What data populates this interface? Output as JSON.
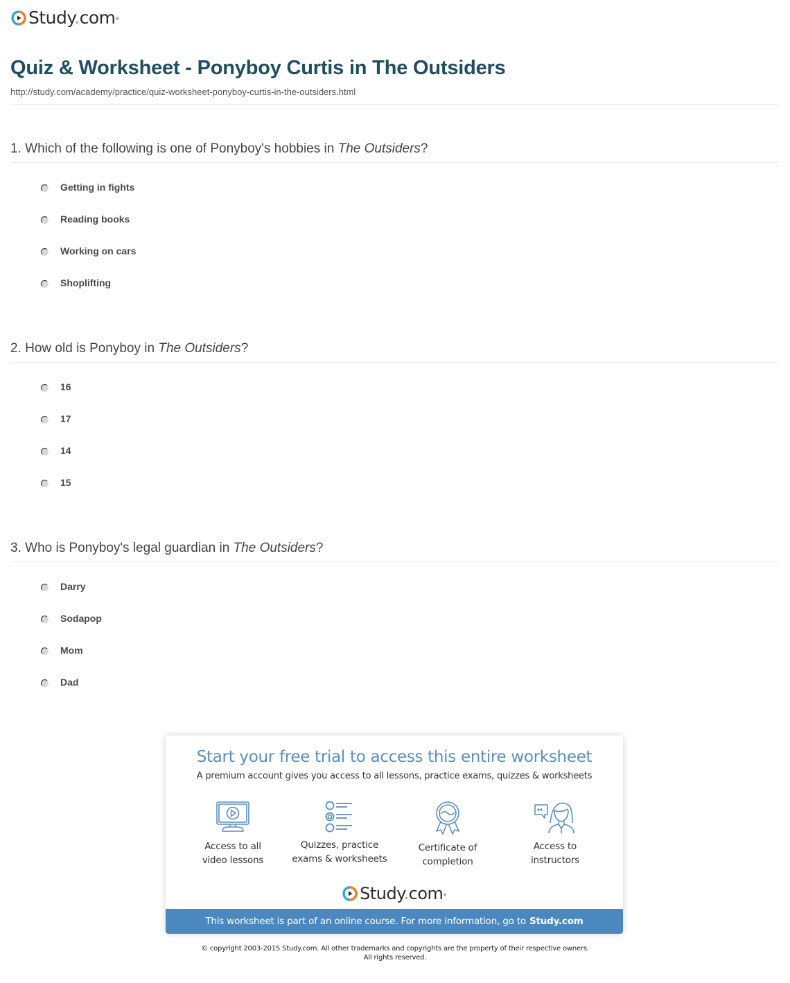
{
  "brand": {
    "name": "Study",
    "dot": ".",
    "tld": "com",
    "trademark": "®",
    "colors": {
      "orange": "#f47b20",
      "teal": "#3aa6c9",
      "title": "#214e5e",
      "promo_blue": "#4b88c0",
      "promo_title": "#5b8fbd"
    }
  },
  "header": {
    "title": "Quiz & Worksheet - Ponyboy Curtis in The Outsiders",
    "url": "http://study.com/academy/practice/quiz-worksheet-ponyboy-curtis-in-the-outsiders.html"
  },
  "questions": [
    {
      "number": "1.",
      "text_before": "Which of the following is one of Ponyboy's hobbies in ",
      "text_italic": "The Outsiders",
      "text_after": "?",
      "options": [
        "Getting in fights",
        "Reading books",
        "Working on cars",
        "Shoplifting"
      ]
    },
    {
      "number": "2.",
      "text_before": "How old is Ponyboy in ",
      "text_italic": "The Outsiders",
      "text_after": "?",
      "options": [
        "16",
        "17",
        "14",
        "15"
      ]
    },
    {
      "number": "3.",
      "text_before": "Who is Ponyboy's legal guardian in ",
      "text_italic": "The Outsiders",
      "text_after": "?",
      "options": [
        "Darry",
        "Sodapop",
        "Mom",
        "Dad"
      ]
    }
  ],
  "promo": {
    "title": "Start your free trial to access this entire worksheet",
    "subtitle": "A premium account gives you access to all lessons, practice exams, quizzes & worksheets",
    "features": [
      {
        "icon": "video-monitor-icon",
        "line1": "Access to all",
        "line2": "video lessons"
      },
      {
        "icon": "quiz-list-icon",
        "line1": "Quizzes, practice",
        "line2": "exams & worksheets"
      },
      {
        "icon": "certificate-ribbon-icon",
        "line1": "Certificate of",
        "line2": "completion"
      },
      {
        "icon": "instructor-chat-icon",
        "line1": "Access to",
        "line2": "instructors"
      }
    ],
    "footer_text": "This worksheet is part of an online course. For more information, go to",
    "footer_link": "Study.com"
  },
  "copyright": {
    "line1": "© copyright 2003-2015 Study.com. All other trademarks and copyrights are the property of their respective owners.",
    "line2": "All rights reserved."
  }
}
